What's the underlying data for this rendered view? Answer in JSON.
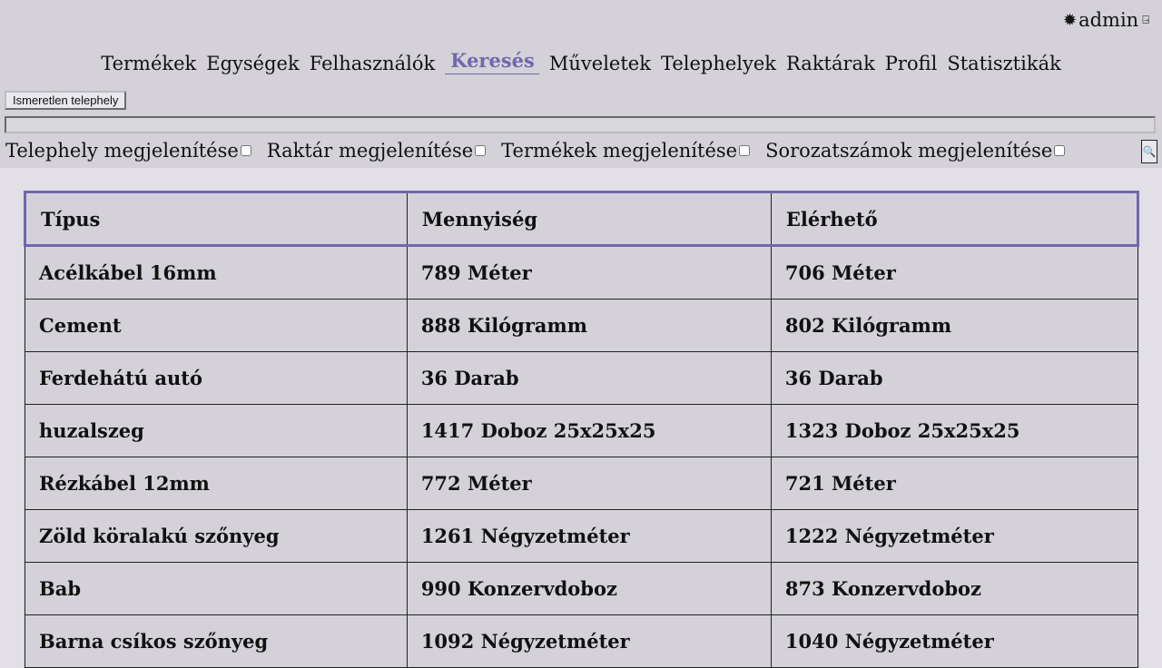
{
  "user": {
    "name": "admin",
    "icon_theme": "sun-icon",
    "icon_logout": "logout-icon"
  },
  "nav": {
    "items": [
      "Termékek",
      "Egységek",
      "Felhasználók",
      "Keresés",
      "Műveletek",
      "Telephelyek",
      "Raktárak",
      "Profil",
      "Statisztikák"
    ],
    "active": "Keresés"
  },
  "site_button": "Ismeretlen telephely",
  "search": {
    "value": "",
    "placeholder": ""
  },
  "options": [
    {
      "label": "Telephely megjelenítése",
      "checked": false
    },
    {
      "label": "Raktár megjelenítése",
      "checked": false
    },
    {
      "label": "Termékek megjelenítése",
      "checked": false
    },
    {
      "label": "Sorozatszámok megjelenítése",
      "checked": false
    }
  ],
  "search_button_icon": "search-icon",
  "table": {
    "headers": [
      "Típus",
      "Mennyiség",
      "Elérhető"
    ],
    "rows": [
      [
        "Acélkábel 16mm",
        "789 Méter",
        "706 Méter"
      ],
      [
        "Cement",
        "888 Kilógramm",
        "802 Kilógramm"
      ],
      [
        "Ferdehátú autó",
        "36 Darab",
        "36 Darab"
      ],
      [
        "huzalszeg",
        "1417 Doboz 25x25x25",
        "1323 Doboz 25x25x25"
      ],
      [
        "Rézkábel 12mm",
        "772 Méter",
        "721 Méter"
      ],
      [
        "Zöld köralakú szőnyeg",
        "1261 Négyzetméter",
        "1222 Négyzetméter"
      ],
      [
        "Bab",
        "990 Konzervdoboz",
        "873 Konzervdoboz"
      ],
      [
        "Barna csíkos szőnyeg",
        "1092 Négyzetméter",
        "1040 Négyzetméter"
      ]
    ]
  },
  "colors": {
    "accent": "#6f68ad",
    "topbar_bg": "#d4d2d8",
    "page_bg": "#e2e0e6"
  }
}
